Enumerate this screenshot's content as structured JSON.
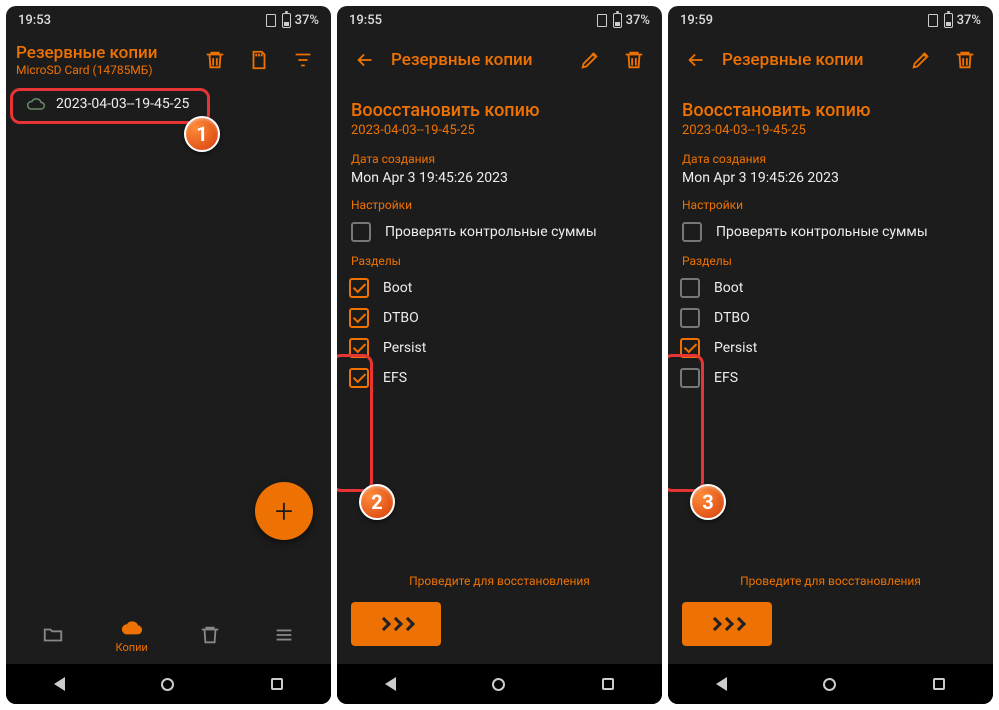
{
  "colors": {
    "accent": "#ee7203",
    "bg": "#1c1c1c",
    "highlight": "#e73434"
  },
  "screen1": {
    "time": "19:53",
    "battery": "37%",
    "title": "Резервные копии",
    "subtitle": "MicroSD Card (14785МБ)",
    "backup_item": "2023-04-03--19-45-25",
    "nav_label": "Копии",
    "callout": "1"
  },
  "screen2": {
    "time": "19:55",
    "battery": "37%",
    "title": "Резервные копии",
    "restore_title": "Воосстановить копию",
    "restore_sub": "2023-04-03--19-45-25",
    "date_label": "Дата создания",
    "date_value": "Mon Apr  3 19:45:26 2023",
    "settings_label": "Настройки",
    "checksums": "Проверять контрольные суммы",
    "partitions_label": "Разделы",
    "partitions": [
      {
        "name": "Boot",
        "checked": true
      },
      {
        "name": "DTBO",
        "checked": true
      },
      {
        "name": "Persist",
        "checked": true
      },
      {
        "name": "EFS",
        "checked": true
      }
    ],
    "swipe_label": "Проведите для восстановления",
    "callout": "2"
  },
  "screen3": {
    "time": "19:59",
    "battery": "37%",
    "title": "Резервные копии",
    "restore_title": "Воосстановить копию",
    "restore_sub": "2023-04-03--19-45-25",
    "date_label": "Дата создания",
    "date_value": "Mon Apr  3 19:45:26 2023",
    "settings_label": "Настройки",
    "checksums": "Проверять контрольные суммы",
    "partitions_label": "Разделы",
    "partitions": [
      {
        "name": "Boot",
        "checked": false
      },
      {
        "name": "DTBO",
        "checked": false
      },
      {
        "name": "Persist",
        "checked": true
      },
      {
        "name": "EFS",
        "checked": false
      }
    ],
    "swipe_label": "Проведите для восстановления",
    "callout": "3"
  }
}
